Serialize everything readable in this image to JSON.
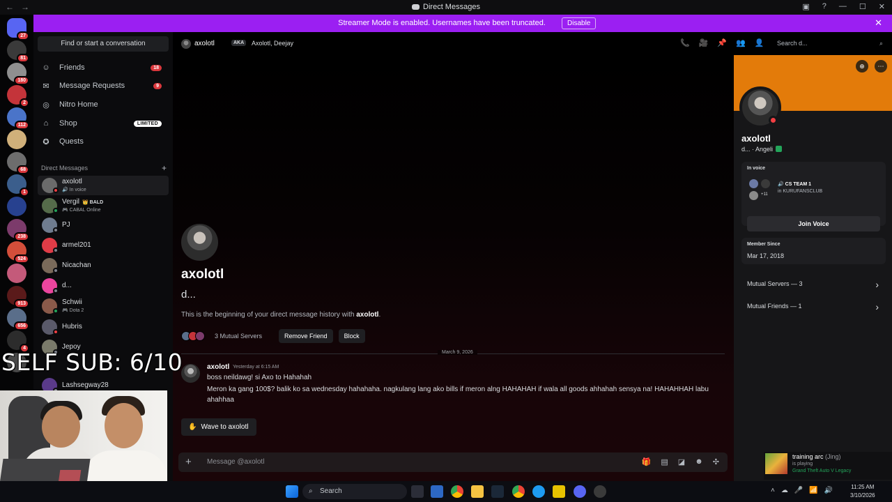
{
  "window": {
    "title": "Direct Messages",
    "nav_back": "←",
    "nav_forward": "→",
    "controls": [
      "▣",
      "?",
      "—",
      "☐",
      "✕"
    ]
  },
  "banner": {
    "text": "Streamer Mode is enabled. Usernames have been truncated.",
    "disable_label": "Disable",
    "close": "✕"
  },
  "servers": [
    {
      "color": "#5865f2",
      "badge": "27"
    },
    {
      "color": "#3a3a3a",
      "badge": "81"
    },
    {
      "color": "#8f8f8f",
      "badge": "180"
    },
    {
      "color": "#c4343a",
      "badge": "2"
    },
    {
      "color": "#4a74c9",
      "badge": "112"
    },
    {
      "color": "#d0b07a",
      "badge": ""
    },
    {
      "color": "#6d6d6d",
      "badge": "68"
    },
    {
      "color": "#3b5e8c",
      "badge": "1"
    },
    {
      "color": "#27418f",
      "badge": ""
    },
    {
      "color": "#7c3b6b",
      "badge": "238"
    },
    {
      "color": "#d34e3a",
      "badge": "524"
    },
    {
      "color": "#c45a7a",
      "badge": ""
    },
    {
      "color": "#5a1a1a",
      "badge": "913"
    },
    {
      "color": "#5a6e8a",
      "badge": "656"
    },
    {
      "color": "#2c2c2c",
      "badge": "4"
    },
    {
      "color": "#494949",
      "badge": ""
    }
  ],
  "sidebar": {
    "find_placeholder": "Find or start a conversation",
    "nav": [
      {
        "label": "Friends",
        "icon": "friends-icon",
        "glyph": "☺",
        "count": "18"
      },
      {
        "label": "Message Requests",
        "icon": "envelope-icon",
        "glyph": "✉",
        "count": "9"
      },
      {
        "label": "Nitro Home",
        "icon": "nitro-icon",
        "glyph": "◎",
        "count": ""
      },
      {
        "label": "Shop",
        "icon": "shop-icon",
        "glyph": "⌂",
        "count": ""
      },
      {
        "label": "Quests",
        "icon": "quests-icon",
        "glyph": "✪",
        "count": ""
      }
    ],
    "shop_badge": "LIMITED",
    "dm_header": "Direct Messages",
    "dm_plus": "+",
    "dms": [
      {
        "name": "axolotl",
        "sub": "🔊 In voice",
        "tag": "",
        "color": "#6b6b6b",
        "status": "#f23f43"
      },
      {
        "name": "Vergil",
        "sub": "🎮 CABAL Online",
        "tag": "👑 BALD",
        "color": "#556b4a",
        "status": "#23a55a"
      },
      {
        "name": "PJ",
        "sub": "",
        "tag": "",
        "color": "#6f7c8f",
        "status": "#80848e"
      },
      {
        "name": "armel201",
        "sub": "",
        "tag": "",
        "color": "#e03c47",
        "status": "#80848e"
      },
      {
        "name": "Nicachan",
        "sub": "",
        "tag": "",
        "color": "#7a6a5a",
        "status": "#80848e"
      },
      {
        "name": "d...",
        "sub": "",
        "tag": "",
        "color": "#eb459e",
        "status": "#80848e"
      },
      {
        "name": "Schwii",
        "sub": "🎮 Dota 2",
        "tag": "",
        "color": "#8a5a4a",
        "status": "#23a55a"
      },
      {
        "name": "Hubris",
        "sub": "",
        "tag": "",
        "color": "#5a5a6a",
        "status": "#f23f43"
      },
      {
        "name": "Jepoy",
        "sub": "",
        "tag": "",
        "color": "#7a7a6a",
        "status": "#80848e"
      },
      {
        "name": "Lashsegway28",
        "sub": "",
        "tag": "",
        "color": "#5a3a8a",
        "status": "#80848e"
      }
    ]
  },
  "header": {
    "name": "axolotl",
    "aka": "AKA",
    "aka_names": "Axolotl, Deejay",
    "icons": [
      "📞",
      "🎥",
      "📌",
      "👥",
      "👤"
    ],
    "search_placeholder": "Search d...",
    "search_icon": "⌕"
  },
  "chat": {
    "display_name": "axolotl",
    "username": "d...",
    "beginning_prefix": "This is the beginning of your direct message history with ",
    "beginning_name": "axolotl",
    "beginning_suffix": ".",
    "mutual_servers": "3 Mutual Servers",
    "remove_friend": "Remove Friend",
    "block": "Block",
    "date_divider": "March 9, 2026",
    "message": {
      "author": "axolotl",
      "timestamp": "Yesterday at 6:15 AM",
      "lines": [
        "boss neildawg! si Axo to Hahahah",
        "Meron ka gang 100$? balik ko sa wednesday hahahaha. nagkulang lang ako bills if meron alng HAHAHAH if wala all goods ahhahah sensya na! HAHAHHAH labu",
        "ahahhaa"
      ]
    },
    "wave_button": "Wave to axolotl",
    "composer_placeholder": "Message @axolotl",
    "composer_plus": "+"
  },
  "profile": {
    "name": "axolotl",
    "sub": "d... · Angeli",
    "in_voice": "In voice",
    "channel": "CS TEAM 1",
    "server": "in KURUFANSCLUB",
    "extra": "+11",
    "join_voice": "Join Voice",
    "member_since_label": "Member Since",
    "member_since": "Mar 17, 2018",
    "mutual_servers": "Mutual Servers — 3",
    "mutual_friends": "Mutual Friends — 1",
    "chev": "›"
  },
  "overlay_text": "SELF SUB: 6/10",
  "activity": {
    "title": "training arc",
    "who": "(Jing)",
    "playing": "is playing",
    "game": "Grand Theft Auto V Legacy"
  },
  "taskbar": {
    "search": "Search",
    "search_icon": "⌕",
    "time": "11:25 AM",
    "date": "3/10/2026",
    "tray": [
      "˄",
      "☁",
      "🎤",
      "📶",
      "🔊",
      "🔋"
    ]
  }
}
